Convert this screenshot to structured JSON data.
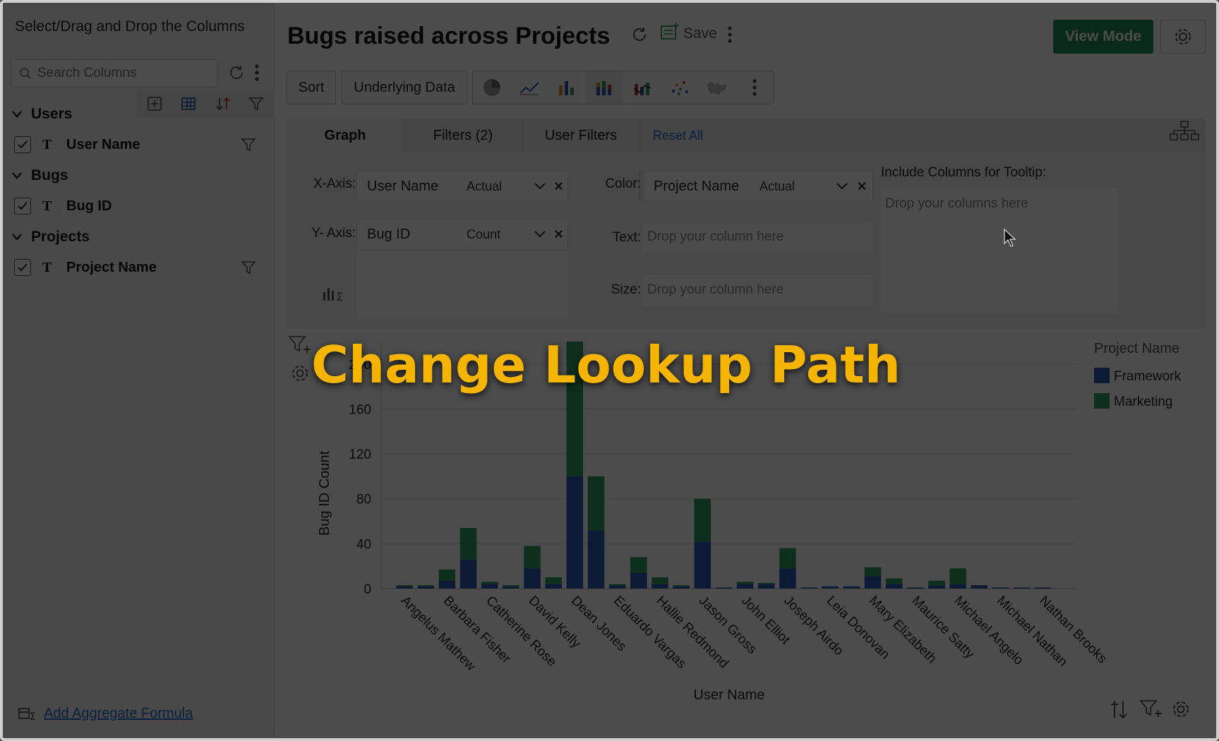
{
  "left_panel": {
    "title": "Select/Drag and Drop the Columns",
    "search_placeholder": "Search Columns",
    "categories": [
      {
        "name": "Users",
        "columns": [
          {
            "name": "User Name",
            "type": "T"
          }
        ]
      },
      {
        "name": "Bugs",
        "columns": [
          {
            "name": "Bug ID",
            "type": "T"
          }
        ]
      },
      {
        "name": "Projects",
        "columns": [
          {
            "name": "Project Name",
            "type": "T"
          }
        ]
      }
    ],
    "add_formula": "Add Aggregate Formula"
  },
  "header": {
    "title": "Bugs raised across Projects",
    "save_label": "Save",
    "view_mode_label": "View Mode"
  },
  "toolbar": {
    "sort_label": "Sort",
    "underlying_label": "Underlying Data"
  },
  "config": {
    "tabs": [
      "Graph",
      "Filters (2)",
      "User Filters"
    ],
    "reset_all": "Reset All",
    "x_axis_label": "X-Axis:",
    "y_axis_label": "Y- Axis:",
    "color_label": "Color:",
    "text_label": "Text:",
    "size_label": "Size:",
    "tooltip_label": "Include Columns for Tooltip:",
    "x_field": {
      "name": "User Name",
      "agg": "Actual"
    },
    "y_field": {
      "name": "Bug ID",
      "agg": "Count"
    },
    "color_field": {
      "name": "Project Name",
      "agg": "Actual"
    },
    "drop_column": "Drop your column here",
    "drop_columns": "Drop your columns here"
  },
  "overlay_title": "Change Lookup Path",
  "colors": {
    "framework": "#2b58b5",
    "marketing": "#2e9e5e",
    "accent": "#1e8a5a",
    "overlay_text": "#f4b400"
  },
  "chart_data": {
    "type": "bar",
    "stacked": true,
    "xlabel": "User Name",
    "ylabel": "Bug ID Count",
    "ylim": [
      0,
      220
    ],
    "yticks": [
      0,
      40,
      80,
      120,
      160,
      200
    ],
    "legend_title": "Project Name",
    "legend_position": "top-right",
    "categories": [
      "Angelus Mathew",
      "",
      "Barbara Fisher",
      "",
      "Catherine Rose",
      "",
      "David Kelly",
      "",
      "Dean Jones",
      "",
      "Eduardo Vargas",
      "",
      "Hallie Redmond",
      "",
      "Jason Gross",
      "",
      "John Elliot",
      "",
      "Joseph Airdo",
      "",
      "Leia Donovan",
      "",
      "Mary Elizabeth",
      "",
      "Maurice Satty",
      "",
      "Michael Angelo",
      "",
      "Michael Nathan",
      "",
      "Nathan Brooks",
      ""
    ],
    "series": [
      {
        "name": "Framework",
        "values": [
          2,
          2,
          7,
          26,
          4,
          2,
          18,
          4,
          100,
          52,
          3,
          14,
          4,
          2,
          42,
          1,
          4,
          4,
          18,
          1,
          2,
          2,
          11,
          4,
          1,
          3,
          4,
          3,
          1,
          1,
          1,
          0
        ]
      },
      {
        "name": "Marketing",
        "values": [
          1,
          1,
          10,
          28,
          2,
          1,
          20,
          6,
          120,
          48,
          1,
          14,
          6,
          1,
          38,
          0,
          2,
          1,
          18,
          0,
          0,
          0,
          8,
          5,
          0,
          4,
          14,
          0,
          0,
          0,
          0,
          0
        ]
      }
    ]
  }
}
